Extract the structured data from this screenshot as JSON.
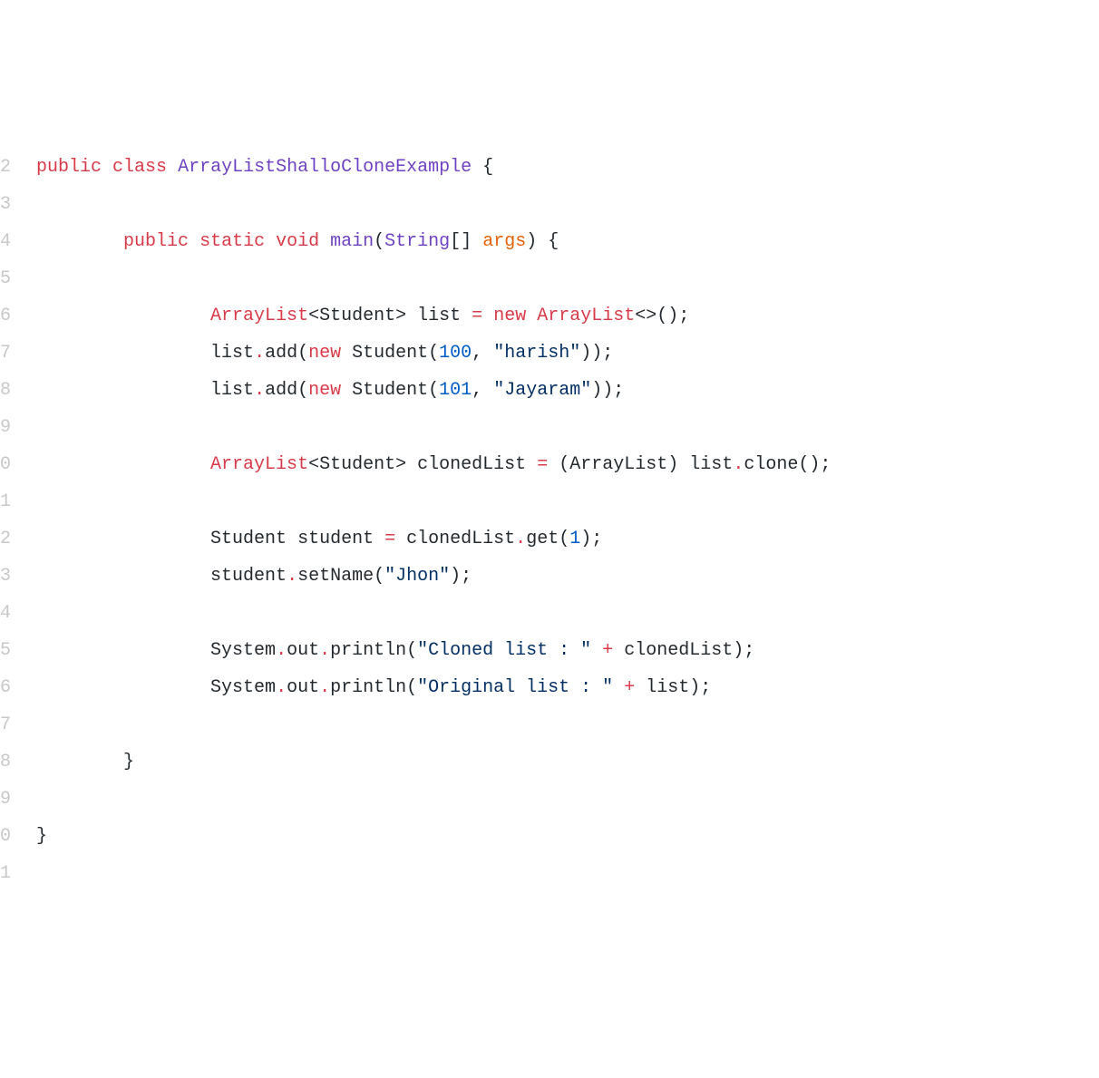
{
  "lineNumbers": [
    "2",
    "3",
    "4",
    "5",
    "6",
    "7",
    "8",
    "9",
    "0",
    "1",
    "2",
    "3",
    "4",
    "5",
    "6",
    "7",
    "8",
    "9",
    "0",
    "1"
  ],
  "tok": {
    "public": "public",
    "class": "class",
    "static": "static",
    "void": "void",
    "new": "new",
    "className": "ArrayListShalloCloneExample",
    "main": "main",
    "String": "String",
    "args": "args",
    "ArrayList": "ArrayList",
    "Student": "Student",
    "list": "list",
    "clonedList": "clonedList",
    "student": "student",
    "add": "add",
    "clone": "clone",
    "get": "get",
    "setName": "setName",
    "System": "System",
    "out": "out",
    "println": "println",
    "n100": "100",
    "n101": "101",
    "n1": "1",
    "sHarish": "\"harish\"",
    "sJayaram": "\"Jayaram\"",
    "sJhon": "\"Jhon\"",
    "sCloned": "\"Cloned list : \"",
    "sOriginal": "\"Original list : \"",
    "lbrace": "{",
    "rbrace": "}",
    "lparen": "(",
    "rparen": ")",
    "lbracket": "[",
    "rbracket": "]",
    "lt": "<",
    "gt": ">",
    "diamond": "<>",
    "semi": ";",
    "comma": ",",
    "eq": "=",
    "plus": "+",
    "dot": ".",
    "sp": " "
  }
}
